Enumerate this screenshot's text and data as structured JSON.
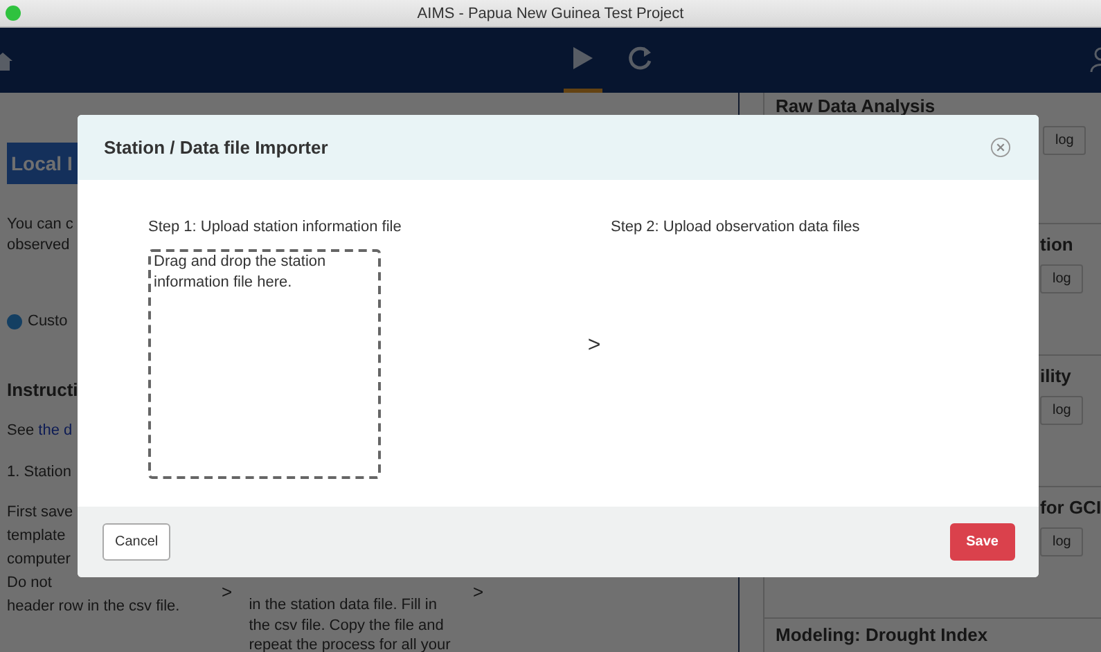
{
  "window": {
    "title": "AIMS - Papua New Guinea Test Project"
  },
  "toolbar": {
    "buttons": [
      {
        "selected": true
      },
      {
        "selected": false
      }
    ]
  },
  "page": {
    "left": {
      "heading": "Local I",
      "intro_lines": [
        "You can c",
        "observed"
      ],
      "option": {
        "label": "Custo",
        "selected": true
      },
      "instructions_heading": "Instructi",
      "see_text": "See ",
      "see_link": "the d",
      "step_heading": "1. Station",
      "step_1_lines": [
        "First save",
        "template",
        "computer",
        "Do not",
        "header row in the csv file."
      ],
      "step_2_lines": [
        "in the station data file. Fill in",
        "the csv file. Copy the file and",
        "repeat the process for all your"
      ],
      "step_arrows": [
        ">",
        ">"
      ]
    },
    "right": {
      "cards": [
        {
          "kind": "full",
          "title": "Raw Data Analysis",
          "button": "log"
        },
        {
          "kind": "partial",
          "title": "tion",
          "button": "log"
        },
        {
          "kind": "partial",
          "title": "ility",
          "button": "log"
        },
        {
          "kind": "partial",
          "title": "for GCI",
          "button": "log"
        },
        {
          "kind": "full",
          "title": "Modeling: Drought Index"
        }
      ]
    }
  },
  "modal": {
    "title": "Station / Data file Importer",
    "steps": [
      {
        "label": "Step 1: Upload station information file",
        "drop_hint": "Drag and drop the station information file here."
      },
      {
        "label": "Step 2: Upload observation data files"
      }
    ],
    "step_arrow": ">",
    "buttons": [
      {
        "label": "Cancel",
        "kind": "secondary"
      },
      {
        "label": "Save",
        "kind": "primary"
      }
    ]
  }
}
